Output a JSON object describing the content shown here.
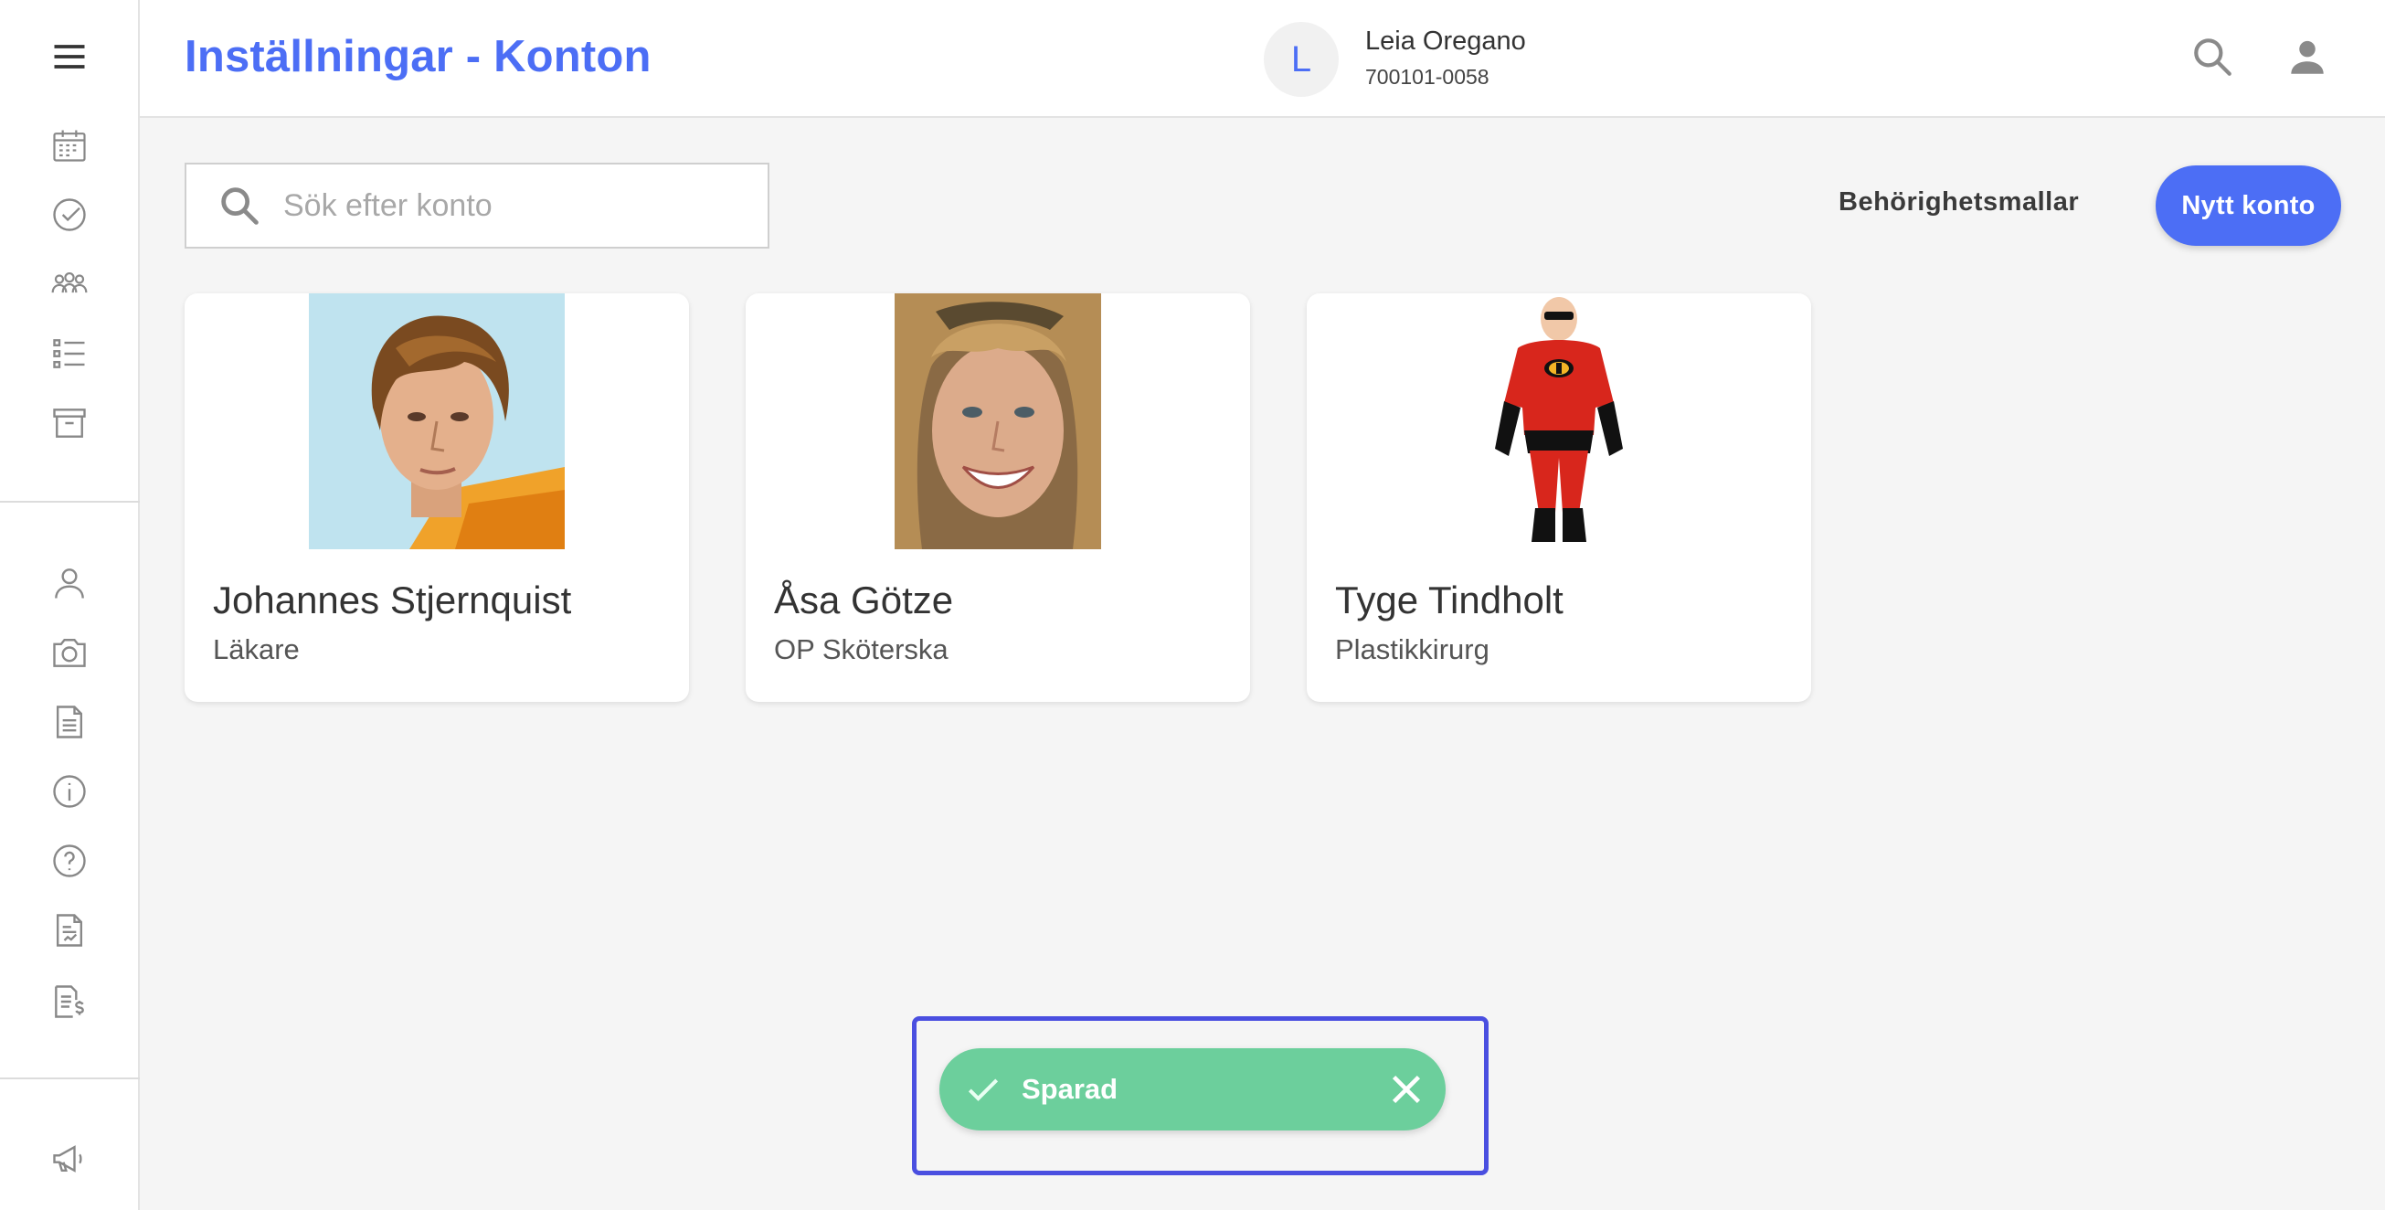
{
  "header": {
    "title": "Inställningar - Konton",
    "patient": {
      "initial": "L",
      "name": "Leia Oregano",
      "id": "700101-0058"
    }
  },
  "toolbar": {
    "search_placeholder": "Sök efter konto",
    "templates_label": "Behörighetsmallar",
    "new_account_label": "Nytt konto"
  },
  "sidebar": {
    "top_icons": [
      "menu-icon",
      "calendar-icon",
      "check-circle-icon",
      "group-icon",
      "list-icon",
      "archive-icon"
    ],
    "middle_icons": [
      "person-icon",
      "camera-icon",
      "document-icon",
      "info-icon",
      "help-icon",
      "report-icon",
      "invoice-icon"
    ],
    "bottom_icons": [
      "megaphone-icon"
    ]
  },
  "accounts": [
    {
      "name": "Johannes Stjernquist",
      "role": "Läkare"
    },
    {
      "name": "Åsa Götze",
      "role": "OP Sköterska"
    },
    {
      "name": "Tyge Tindholt",
      "role": "Plastikkirurg"
    }
  ],
  "toast": {
    "message": "Sparad"
  },
  "colors": {
    "accent": "#4c6ef5",
    "success": "#6ccf9c",
    "highlight": "#4a4fe0"
  }
}
